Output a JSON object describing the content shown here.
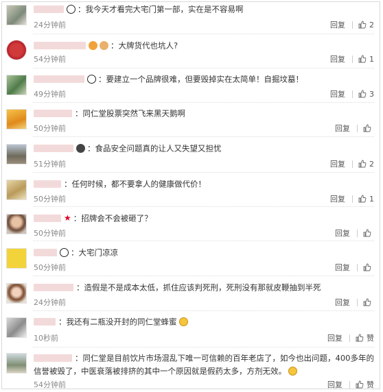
{
  "labels": {
    "reply": "回复"
  },
  "comments": [
    {
      "text": "我今天才看完大宅门第一部，实在是不容易啊",
      "time": "24分钟前",
      "likes": "2",
      "badge": "panda"
    },
    {
      "text": "大牌货代也坑人?",
      "time": "54分钟前",
      "likes": "1",
      "badge": "orange"
    },
    {
      "text": "要建立一个品牌很难，但要毁掉实在太简单！自掘坟墓！",
      "time": "49分钟前",
      "likes": "3",
      "badge": "panda"
    },
    {
      "text": "同仁堂股票突然飞来黑天鹅啊",
      "time": "50分钟前",
      "likes": "",
      "badge": ""
    },
    {
      "text": "食品安全问题真的让人又失望又担忧",
      "time": "51分钟前",
      "likes": "2",
      "badge": "circle"
    },
    {
      "text": "任何时候，都不要拿人的健康做代价！",
      "time": "50分钟前",
      "likes": "1",
      "badge": ""
    },
    {
      "text": "招牌会不会被砸了？",
      "time": "50分钟前",
      "likes": "",
      "badge": "star"
    },
    {
      "text": "大宅门凉凉",
      "time": "50分钟前",
      "likes": "",
      "badge": "panda"
    },
    {
      "text": "造假是不是成本太低，抓住应该判死刑，死刑没有那就皮鞭抽到半死",
      "time": "24分钟前",
      "likes": "",
      "badge": ""
    },
    {
      "text": "我还有二瓶没开封的同仁堂蜂蜜",
      "time": "10秒前",
      "likes": "赞",
      "badge": ""
    },
    {
      "text": "同仁堂是目前饮片市场混乱下唯一可信赖的百年老店了，如今也出问题，400多年的信誉被毁了，中医衰落被排挤的其中一个原因就是假药太多，方剂无效。",
      "time": "54分钟前",
      "likes": "赞",
      "badge": ""
    }
  ]
}
